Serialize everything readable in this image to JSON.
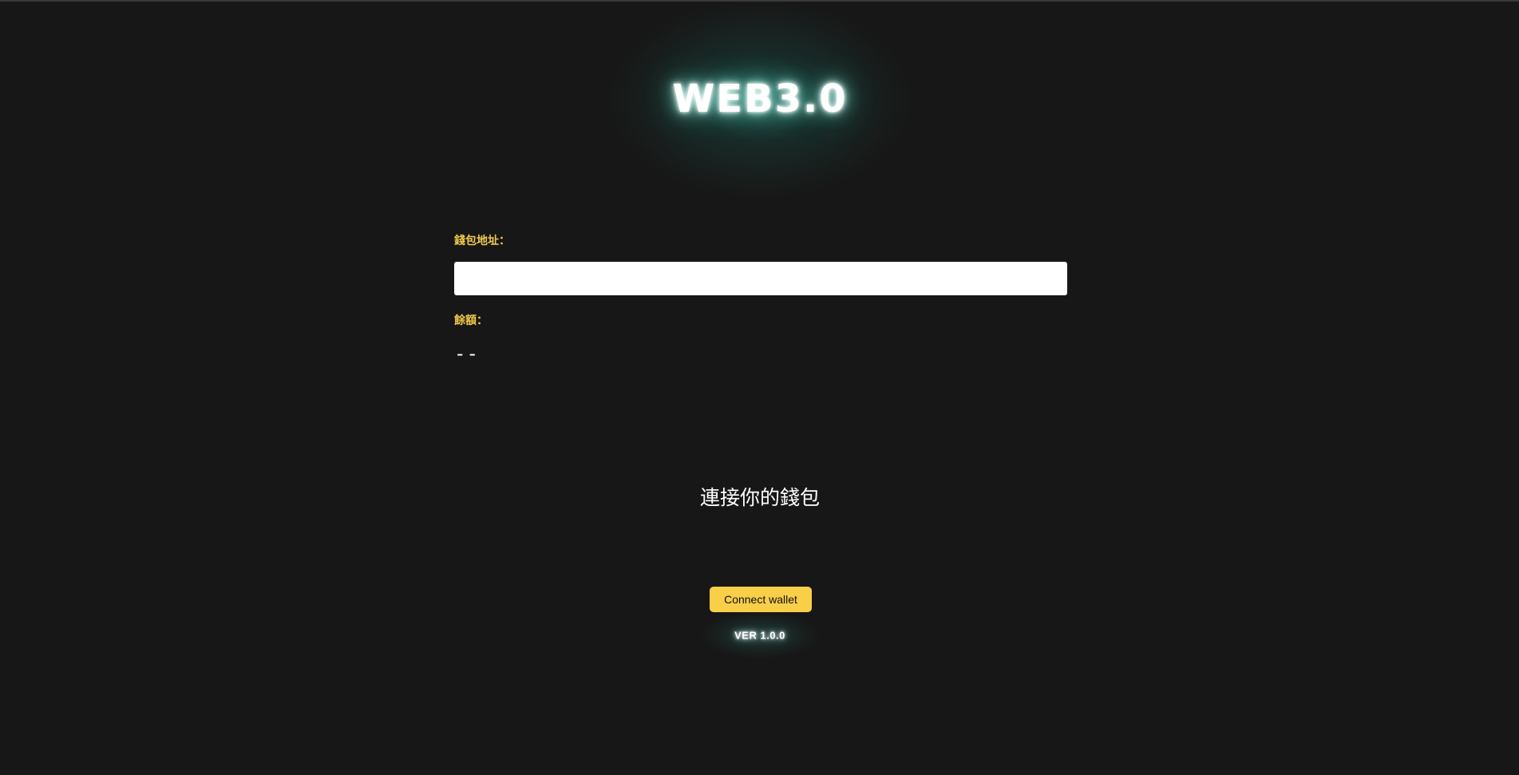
{
  "header": {
    "logo_text": "WEB3.0"
  },
  "wallet": {
    "address_label": "錢包地址：",
    "address_value": "",
    "address_placeholder": "",
    "balance_label": "餘額：",
    "balance_value": "--"
  },
  "connect": {
    "heading": "連接你的錢包",
    "button_label": "Connect wallet"
  },
  "footer": {
    "version": "VER 1.0.0"
  },
  "colors": {
    "background": "#171717",
    "accent": "#f9cf4a",
    "label": "#f2c94c",
    "glow": "#2f9c8a"
  }
}
